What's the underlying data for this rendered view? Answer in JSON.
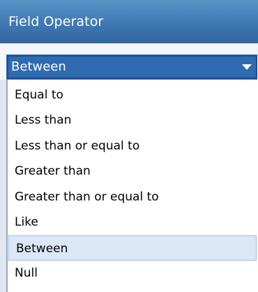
{
  "header": {
    "title": "Field Operator"
  },
  "select": {
    "value": "Between"
  },
  "options": [
    {
      "label": "Equal to",
      "selected": false
    },
    {
      "label": "Less than",
      "selected": false
    },
    {
      "label": "Less than or equal to",
      "selected": false
    },
    {
      "label": "Greater than",
      "selected": false
    },
    {
      "label": "Greater than or equal to",
      "selected": false
    },
    {
      "label": "Like",
      "selected": false
    },
    {
      "label": "Between",
      "selected": true
    },
    {
      "label": "Null",
      "selected": false
    }
  ],
  "icons": {
    "dropdown_arrow": "chevron-down-icon"
  }
}
